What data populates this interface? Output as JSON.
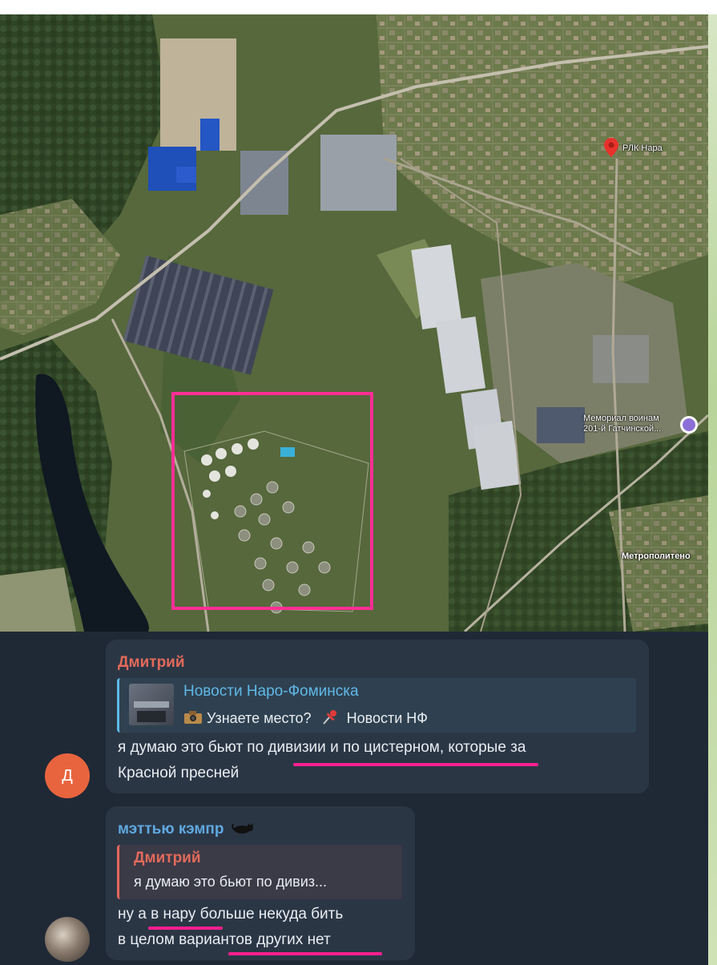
{
  "map": {
    "pin_label": "РЛК Нара",
    "memorial_label": "Мемориал воинам 201-й Гатчинской...",
    "metro_label": "Метрополитено",
    "highlight_color": "#ff2e95"
  },
  "messages": [
    {
      "sender": "Дмитрий",
      "sender_color": "#e26a5a",
      "avatar_initial": "Д",
      "avatar_color": "#e8643e",
      "reply": {
        "title": "Новости Наро-Фоминска",
        "title_color": "#5fb8e8",
        "preview_part1": "Узнаете место?",
        "preview_part2": "Новости НФ"
      },
      "line1": "я думаю это бьют по дивизии и по цистерном, которые за",
      "line2": "Красной пресней"
    },
    {
      "sender": "мэттью кэмпр",
      "sender_color": "#5fa8e0",
      "reply": {
        "title": "Дмитрий",
        "title_color": "#e26a5a",
        "preview": "я думаю это бьют по дивиз..."
      },
      "line1": "ну а в нару больше некуда бить",
      "line2": "в целом вариантов других нет"
    }
  ],
  "colors": {
    "underline": "#ff1f8f"
  }
}
